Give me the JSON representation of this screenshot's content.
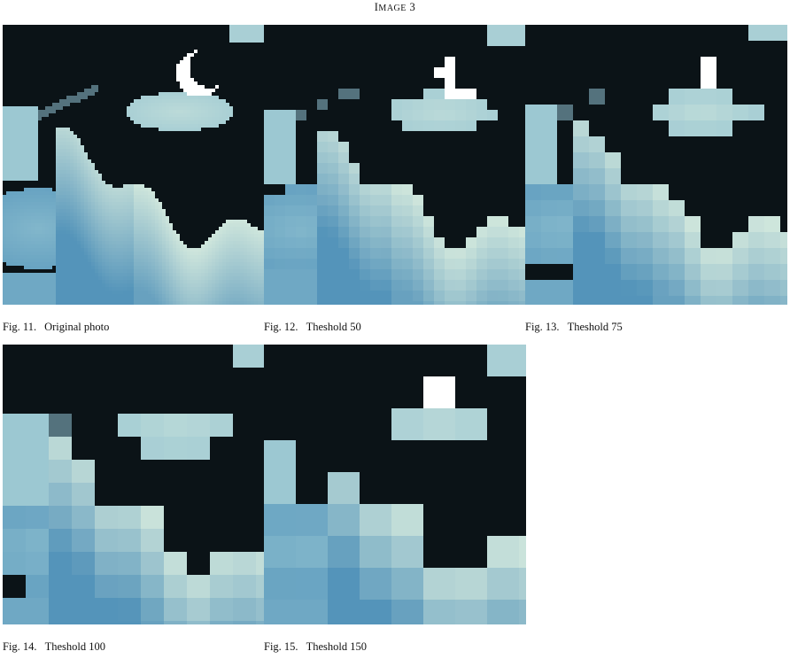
{
  "heading": {
    "first": "I",
    "rest": "MAGE",
    "num": "3"
  },
  "figures": [
    {
      "fig_label": "Fig. 11.",
      "caption": "Original photo",
      "block": 0
    },
    {
      "fig_label": "Fig. 12.",
      "caption": "Theshold 50",
      "block": 12
    },
    {
      "fig_label": "Fig. 13.",
      "caption": "Theshold 75",
      "block": 18
    },
    {
      "fig_label": "Fig. 14.",
      "caption": "Theshold 100",
      "block": 26
    },
    {
      "fig_label": "Fig. 15.",
      "caption": "Theshold 150",
      "block": 36
    }
  ],
  "colors": {
    "sky": "#0b1317",
    "cloud_light": "#cfe6dc",
    "cloud_mid": "#8fc0d0",
    "cloud_deep": "#4e90b8",
    "moon": "#ffffff"
  }
}
